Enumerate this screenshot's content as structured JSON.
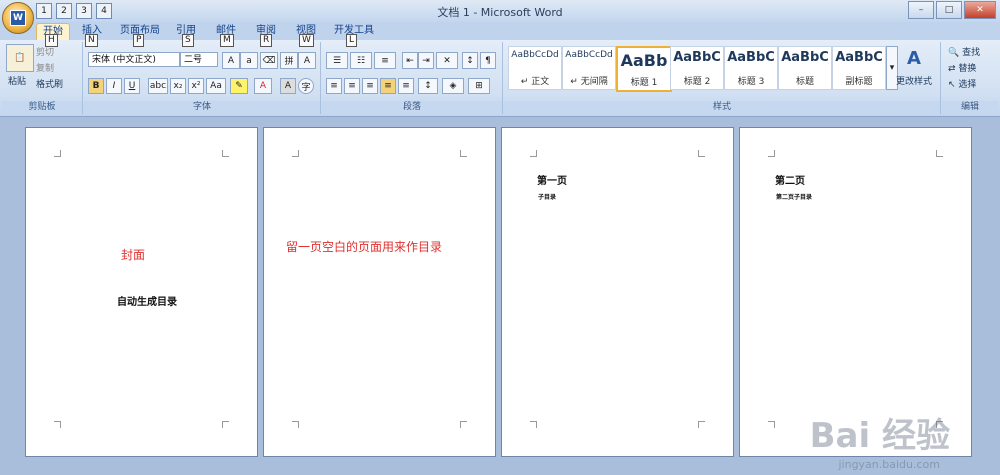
{
  "window": {
    "title": "文档 1 - Microsoft Word",
    "controls": [
      "–",
      "□",
      "✕"
    ]
  },
  "office_button": {
    "logo": "W"
  },
  "keytips_qat": [
    "1",
    "2",
    "3",
    "4"
  ],
  "tabs": [
    {
      "label": "开始",
      "keytip": "H"
    },
    {
      "label": "插入",
      "keytip": "N"
    },
    {
      "label": "页面布局",
      "keytip": "P"
    },
    {
      "label": "引用",
      "keytip": "S"
    },
    {
      "label": "邮件",
      "keytip": "M"
    },
    {
      "label": "审阅",
      "keytip": "R"
    },
    {
      "label": "视图",
      "keytip": "W"
    },
    {
      "label": "开发工具",
      "keytip": "L"
    }
  ],
  "clipboard": {
    "paste": "粘贴",
    "cut": "剪切",
    "copy": "复制",
    "format_painter": "格式刷",
    "label": "剪贴板"
  },
  "font": {
    "name": "宋体 (中文正文)",
    "size": "二号",
    "label": "字体"
  },
  "paragraph": {
    "label": "段落"
  },
  "styles": {
    "label": "样式",
    "items": [
      {
        "preview": "AaBbCcDd",
        "name": "↵ 正文"
      },
      {
        "preview": "AaBbCcDd",
        "name": "↵ 无间隔"
      },
      {
        "preview": "AaBb",
        "name": "标题 1"
      },
      {
        "preview": "AaBbC",
        "name": "标题 2"
      },
      {
        "preview": "AaBbC",
        "name": "标题 3"
      },
      {
        "preview": "AaBbC",
        "name": "标题"
      },
      {
        "preview": "AaBbC",
        "name": "副标题"
      }
    ],
    "change": "更改样式"
  },
  "editing": {
    "find": "查找",
    "replace": "替换",
    "select": "选择",
    "label": "编辑"
  },
  "pages": [
    {
      "red_text": "封面",
      "bold_text": "自动生成目录"
    },
    {
      "red_text": "留一页空白的页面用来作目录"
    },
    {
      "heading": "第一页",
      "sub": "子目录"
    },
    {
      "heading": "第二页",
      "sub": "第二页子目录"
    }
  ],
  "watermark": {
    "brand": "Bai 经验",
    "url": "jingyan.baidu.com"
  }
}
